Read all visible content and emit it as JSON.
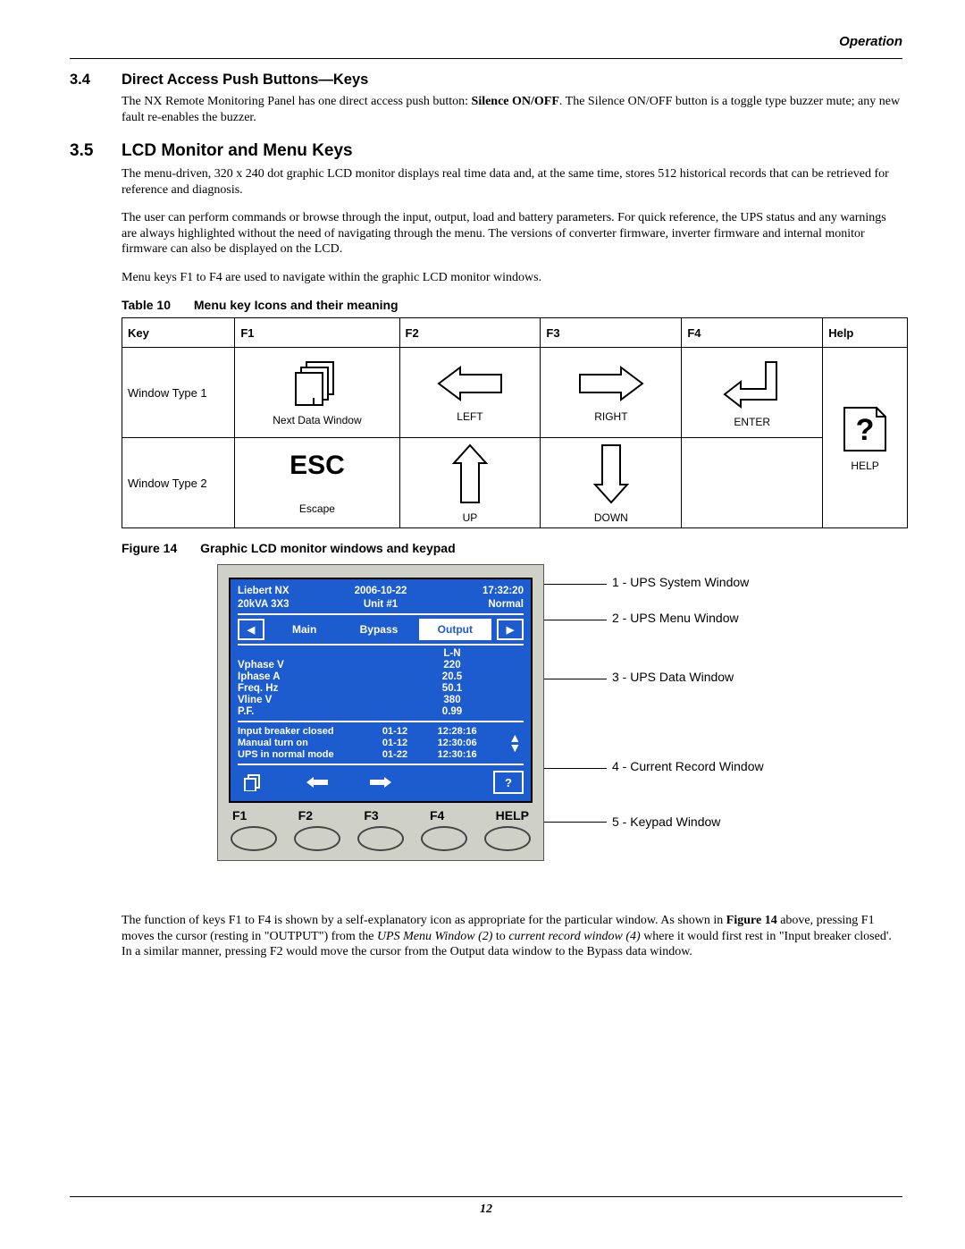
{
  "running_head": "Operation",
  "section34": {
    "num": "3.4",
    "title": "Direct Access Push Buttons—Keys",
    "body_a": "The NX Remote Monitoring Panel has one direct access push button: ",
    "bold": "Silence ON/OFF",
    "body_b": ". The Silence ON/OFF button is a toggle type buzzer mute; any new fault re-enables the buzzer."
  },
  "section35": {
    "num": "3.5",
    "title": "LCD Monitor and Menu Keys",
    "p1": "The menu-driven, 320 x 240 dot graphic LCD monitor displays real time data and, at the same time, stores 512 historical records that can be retrieved for reference and diagnosis.",
    "p2": "The user can perform commands or browse through the input, output, load and battery parameters. For quick reference, the UPS status and any warnings are always highlighted without the need of navigating through the menu. The versions of converter firmware, inverter firmware and internal monitor firmware can also be displayed on the LCD.",
    "p3": "Menu keys F1 to F4 are used to navigate within the graphic LCD monitor windows."
  },
  "table10": {
    "num": "Table 10",
    "title": "Menu key Icons and their meaning",
    "headers": {
      "key": "Key",
      "f1": "F1",
      "f2": "F2",
      "f3": "F3",
      "f4": "F4",
      "help": "Help"
    },
    "row1": {
      "label": "Window Type 1",
      "f1": "Next Data Window",
      "f2": "LEFT",
      "f3": "RIGHT",
      "f4": "ENTER",
      "help": "HELP"
    },
    "row2": {
      "label": "Window Type 2",
      "f1": "Escape",
      "f1_icon_text": "ESC",
      "f2": "UP",
      "f3": "DOWN"
    }
  },
  "figure14": {
    "num": "Figure 14",
    "title": "Graphic LCD monitor windows and keypad"
  },
  "lcd": {
    "sys": {
      "brand": "Liebert  NX",
      "model": "20kVA 3X3",
      "date": "2006-10-22",
      "unit": "Unit #1",
      "time": "17:32:20",
      "status": "Normal"
    },
    "menu": {
      "left_icon": "◀",
      "tab1": "Main",
      "tab2": "Bypass",
      "tab3": "Output",
      "right_icon": "▶"
    },
    "data": {
      "head": "L-N",
      "r1k": "Vphase V",
      "r1v": "220",
      "r2k": "Iphase A",
      "r2v": "20.5",
      "r3k": "Freq. Hz",
      "r3v": "50.1",
      "r4k": "Vline V",
      "r4v": "380",
      "r5k": "P.F.",
      "r5v": "0.99"
    },
    "records": {
      "r1a": "Input breaker closed",
      "r1b": "01-12",
      "r1c": "12:28:16",
      "r2a": "Manual turn on",
      "r2b": "01-12",
      "r2c": "12:30:06",
      "r3a": "UPS in normal mode",
      "r3b": "01-22",
      "r3c": "12:30:16"
    },
    "kp": {
      "help_glyph": "?"
    },
    "fn": {
      "f1": "F1",
      "f2": "F2",
      "f3": "F3",
      "f4": "F4",
      "help": "HELP"
    }
  },
  "callouts": {
    "c1": "1 - UPS System Window",
    "c2": "2 - UPS Menu Window",
    "c3": "3 - UPS Data Window",
    "c4": "4 - Current Record Window",
    "c5": "5 - Keypad Window"
  },
  "footer_para": {
    "a": "The function of keys F1 to F4 is shown by a self-explanatory icon as appropriate for the particular window. As shown in ",
    "fig_bold": "Figure 14",
    "b": " above, pressing F1 moves the cursor (resting in \"OUTPUT\") from the ",
    "ital1": "UPS Menu Window (2)",
    "c": " to ",
    "ital2": "current record window (4)",
    "d": " where it would first rest in \"Input breaker closed'. In a similar manner, pressing F2 would move the cursor from the Output data window to the Bypass data window."
  },
  "page_num": "12"
}
